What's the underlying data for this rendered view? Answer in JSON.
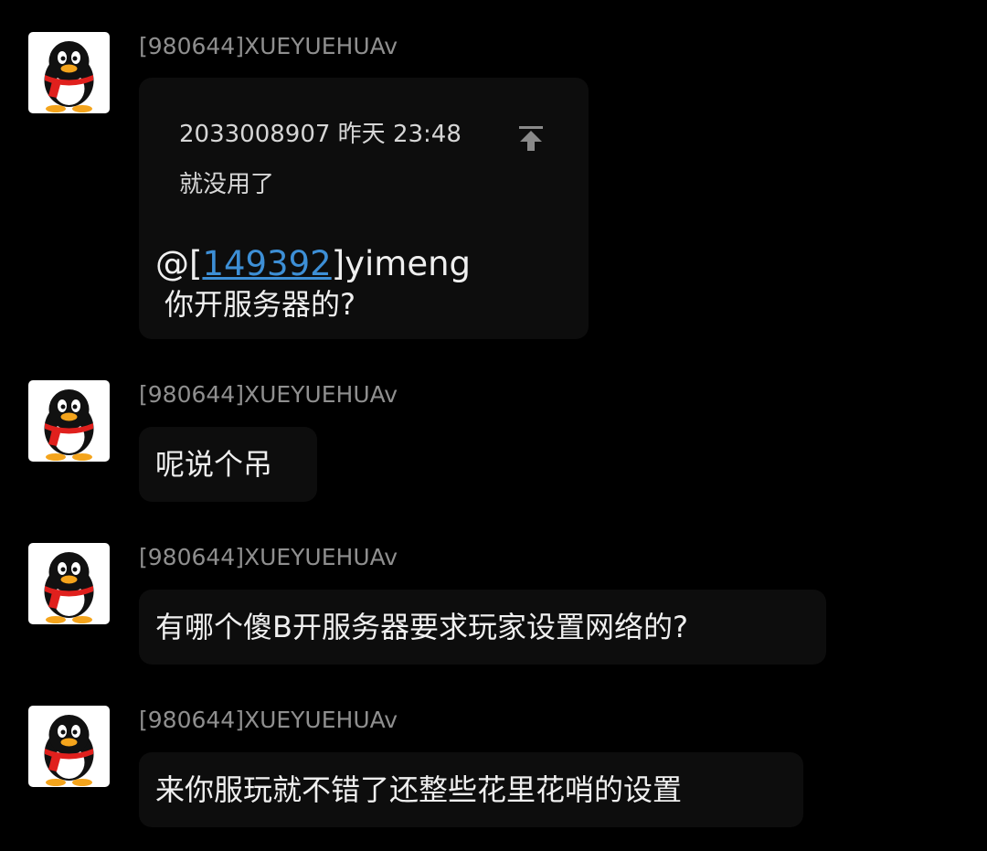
{
  "colors": {
    "background": "#000000",
    "bubble": "#0d0d0d",
    "sender_text": "#8f8f8f",
    "message_text": "#efefef",
    "mention_link": "#3d8fd6"
  },
  "messages": [
    {
      "avatar_icon": "qq-penguin-icon",
      "sender": "[980644]XUEYUEHUAv",
      "quote": {
        "header": "2033008907 昨天 23:48",
        "text": "就没用了",
        "jump_icon": "jump-to-top-icon"
      },
      "reply": {
        "mention_prefix": "@[",
        "mention_id": "149392",
        "mention_suffix": "]yimeng",
        "text": "你开服务器的?"
      }
    },
    {
      "avatar_icon": "qq-penguin-icon",
      "sender": "[980644]XUEYUEHUAv",
      "text": "呢说个吊"
    },
    {
      "avatar_icon": "qq-penguin-icon",
      "sender": "[980644]XUEYUEHUAv",
      "text": "有哪个傻B开服务器要求玩家设置网络的?"
    },
    {
      "avatar_icon": "qq-penguin-icon",
      "sender": "[980644]XUEYUEHUAv",
      "text": "来你服玩就不错了还整些花里花哨的设置"
    }
  ]
}
